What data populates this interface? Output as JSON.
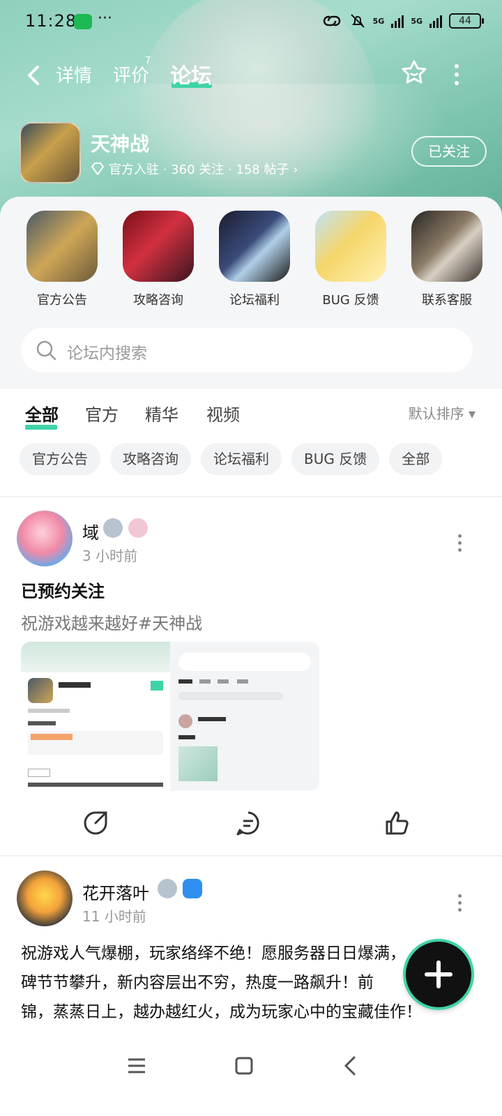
{
  "status_bar": {
    "time": "11:28",
    "more": "···",
    "battery": "44",
    "net1": "5G",
    "net2": "5G"
  },
  "nav": {
    "tabs": [
      {
        "label": "详情"
      },
      {
        "label": "评价"
      },
      {
        "label": "论坛"
      }
    ],
    "review_sup": "7"
  },
  "game": {
    "name": "天神战",
    "meta": "官方入驻 · 360 关注 · 158 帖子 ›",
    "follow": "已关注"
  },
  "quick_entries": [
    {
      "label": "官方公告"
    },
    {
      "label": "攻略咨询"
    },
    {
      "label": "论坛福利"
    },
    {
      "label": "BUG 反馈"
    },
    {
      "label": "联系客服"
    }
  ],
  "search": {
    "placeholder": "论坛内搜索"
  },
  "tabs": [
    {
      "label": "全部"
    },
    {
      "label": "官方"
    },
    {
      "label": "精华"
    },
    {
      "label": "视频"
    }
  ],
  "sort": "默认排序 ▾",
  "chips": [
    {
      "label": "官方公告"
    },
    {
      "label": "攻略咨询"
    },
    {
      "label": "论坛福利"
    },
    {
      "label": "BUG 反馈"
    },
    {
      "label": "全部"
    }
  ],
  "post1": {
    "user": "域",
    "time": "3 小时前",
    "title": "已预约关注",
    "body": "祝游戏越来越好#天神战"
  },
  "post2": {
    "user": "花开落叶",
    "time": "11 小时前",
    "lines": [
      "祝游戏人气爆棚，玩家络绎不绝！愿服务器日日爆满，",
      "碑节节攀升，新内容层出不穷，热度一路飙升！前",
      "锦，蒸蒸日上，越办越红火，成为玩家心中的宝藏佳作！"
    ]
  },
  "colors": {
    "accent": "#3fd3a8",
    "header_bg": "#8fd0bd"
  }
}
